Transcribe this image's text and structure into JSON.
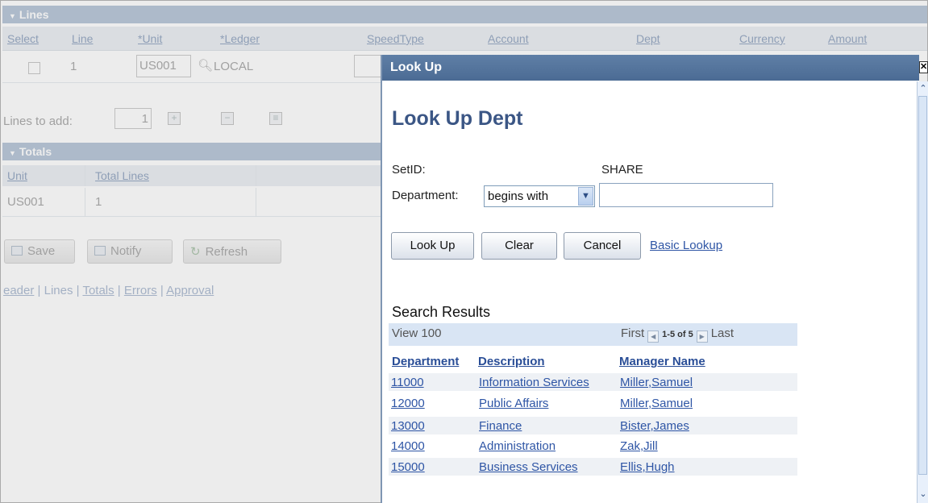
{
  "background": {
    "lines_section": {
      "title": "Lines",
      "columns": [
        "Select",
        "Line",
        "*Unit",
        "*Ledger",
        "SpeedType",
        "Account",
        "Dept",
        "Currency",
        "Amount"
      ],
      "row": {
        "line": "1",
        "unit": "US001",
        "ledger": "LOCAL"
      }
    },
    "lines_to_add": {
      "label": "Lines to add:",
      "value": "1"
    },
    "totals_section": {
      "title": "Totals",
      "columns": [
        "Unit",
        "Total Lines"
      ],
      "row": {
        "unit": "US001",
        "total_lines": "1"
      }
    },
    "buttons": {
      "save": "Save",
      "notify": "Notify",
      "refresh": "Refresh"
    },
    "footer_links": [
      "eader",
      "Lines",
      "Totals",
      "Errors",
      "Approval"
    ],
    "footer_sep": " | "
  },
  "modal": {
    "title_bar": "Look Up",
    "heading": "Look Up Dept",
    "setid_label": "SetID:",
    "setid_value": "SHARE",
    "department_label": "Department:",
    "operator": "begins with",
    "department_value": "",
    "buttons": {
      "lookup": "Look Up",
      "clear": "Clear",
      "cancel": "Cancel"
    },
    "basic_lookup": "Basic Lookup",
    "search_results": {
      "heading": "Search Results",
      "view": "View 100",
      "first": "First",
      "count": "1-5 of 5",
      "last": "Last",
      "columns": [
        "Department",
        "Description",
        "Manager Name"
      ],
      "rows": [
        {
          "dept": "11000",
          "desc": "Information Services",
          "manager": "Miller,Samuel"
        },
        {
          "dept": "12000",
          "desc": "Public Affairs",
          "manager": "Miller,Samuel"
        },
        {
          "dept": "13000",
          "desc": "Finance",
          "manager": "Bister,James"
        },
        {
          "dept": "14000",
          "desc": "Administration",
          "manager": "Zak,Jill"
        },
        {
          "dept": "15000",
          "desc": "Business Services",
          "manager": "Ellis,Hugh"
        }
      ]
    }
  },
  "colors": {
    "title_bar": "#4b6b94",
    "heading": "#3b5685",
    "link": "#2e55a5",
    "results_bar": "#d9e5f4"
  }
}
